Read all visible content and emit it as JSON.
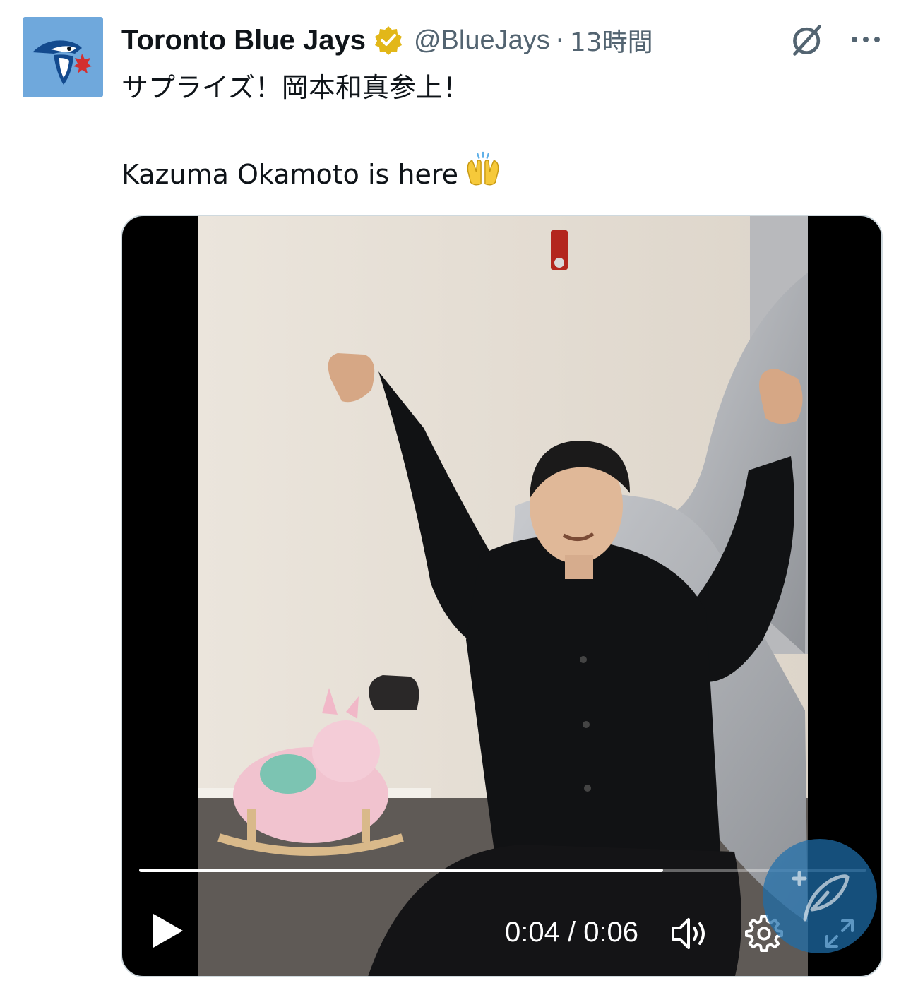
{
  "author": {
    "name": "Toronto Blue Jays",
    "handle": "@BlueJays",
    "separator": "·",
    "time": "13時間",
    "verified": true
  },
  "tweet": {
    "line1": "サプライズ！岡本和真参上！",
    "line2": "Kazuma Okamoto is here"
  },
  "video": {
    "current_time": "0:04",
    "duration": "0:06",
    "time_display": "0:04 / 0:06",
    "progress": 0.72
  },
  "icons": {
    "avatar": "blue-jays-logo",
    "verified": "verified-badge-icon",
    "grok": "grok-icon",
    "more": "more-icon",
    "emoji": "raising-hands-emoji",
    "play": "play-icon",
    "volume": "volume-icon",
    "settings": "gear-icon",
    "fullscreen": "fullscreen-icon",
    "floating": "quill-icon"
  },
  "colors": {
    "avatar_bg": "#6fa8dc",
    "verified_gold": "#e2b719",
    "secondary_text": "#536471",
    "floating_button": "#1d6eaa"
  }
}
